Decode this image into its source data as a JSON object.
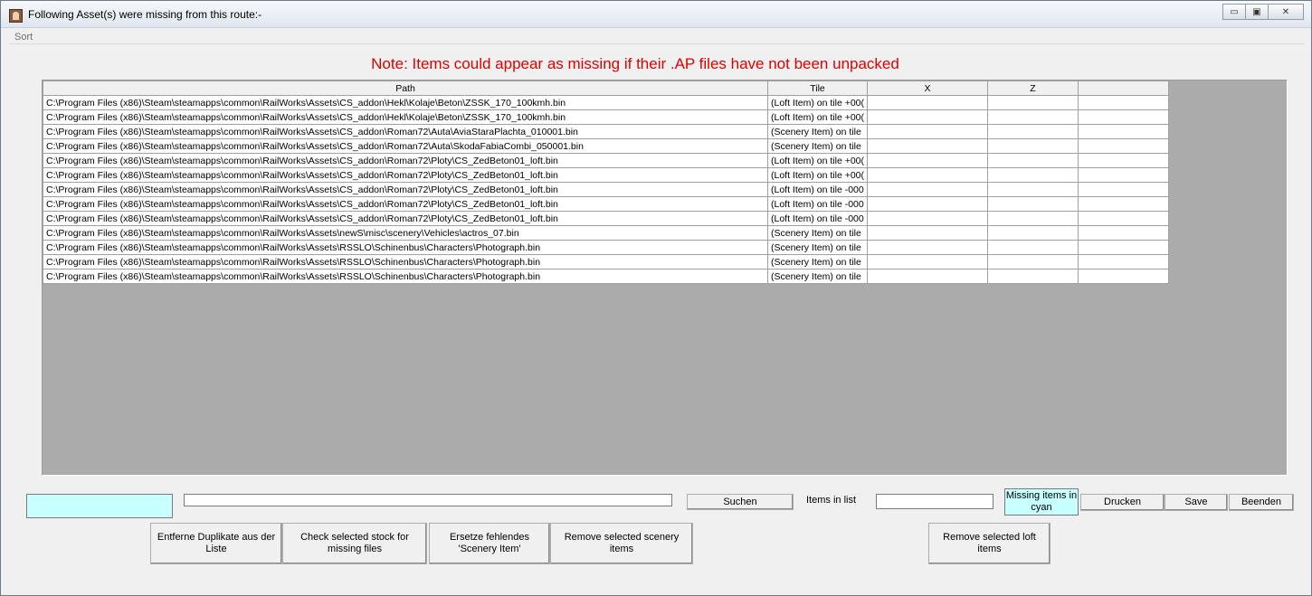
{
  "window": {
    "title": "Following Asset(s) were missing from this route:-",
    "minimize_glyph": "▭",
    "maximize_glyph": "▣",
    "close_glyph": "✕"
  },
  "menu": {
    "sort": "Sort"
  },
  "note": "Note: Items could appear as missing if their .AP files have not been unpacked",
  "table": {
    "headers": [
      "Path",
      "Tile",
      "X",
      "Z",
      ""
    ],
    "rows": [
      [
        "C:\\Program Files (x86)\\Steam\\steamapps\\common\\RailWorks\\Assets\\CS_addon\\Hekl\\Kolaje\\Beton\\ZSSK_170_100kmh.bin",
        "(Loft Item) on tile +00(",
        "",
        "",
        ""
      ],
      [
        "C:\\Program Files (x86)\\Steam\\steamapps\\common\\RailWorks\\Assets\\CS_addon\\Hekl\\Kolaje\\Beton\\ZSSK_170_100kmh.bin",
        "(Loft Item) on tile +00(",
        "",
        "",
        ""
      ],
      [
        "C:\\Program Files (x86)\\Steam\\steamapps\\common\\RailWorks\\Assets\\CS_addon\\Roman72\\Auta\\AviaStaraPlachta_010001.bin",
        "(Scenery Item) on tile",
        "",
        "",
        ""
      ],
      [
        "C:\\Program Files (x86)\\Steam\\steamapps\\common\\RailWorks\\Assets\\CS_addon\\Roman72\\Auta\\SkodaFabiaCombi_050001.bin",
        "(Scenery Item) on tile",
        "",
        "",
        ""
      ],
      [
        "C:\\Program Files (x86)\\Steam\\steamapps\\common\\RailWorks\\Assets\\CS_addon\\Roman72\\Ploty\\CS_ZedBeton01_loft.bin",
        "(Loft Item) on tile +00(",
        "",
        "",
        ""
      ],
      [
        "C:\\Program Files (x86)\\Steam\\steamapps\\common\\RailWorks\\Assets\\CS_addon\\Roman72\\Ploty\\CS_ZedBeton01_loft.bin",
        "(Loft Item) on tile +00(",
        "",
        "",
        ""
      ],
      [
        "C:\\Program Files (x86)\\Steam\\steamapps\\common\\RailWorks\\Assets\\CS_addon\\Roman72\\Ploty\\CS_ZedBeton01_loft.bin",
        "(Loft Item) on tile -000",
        "",
        "",
        ""
      ],
      [
        "C:\\Program Files (x86)\\Steam\\steamapps\\common\\RailWorks\\Assets\\CS_addon\\Roman72\\Ploty\\CS_ZedBeton01_loft.bin",
        "(Loft Item) on tile -000",
        "",
        "",
        ""
      ],
      [
        "C:\\Program Files (x86)\\Steam\\steamapps\\common\\RailWorks\\Assets\\CS_addon\\Roman72\\Ploty\\CS_ZedBeton01_loft.bin",
        "(Loft Item) on tile -000",
        "",
        "",
        ""
      ],
      [
        "C:\\Program Files (x86)\\Steam\\steamapps\\common\\RailWorks\\Assets\\newS\\misc\\scenery\\Vehicles\\actros_07.bin",
        "(Scenery Item) on tile",
        "",
        "",
        ""
      ],
      [
        "C:\\Program Files (x86)\\Steam\\steamapps\\common\\RailWorks\\Assets\\RSSLO\\Schinenbus\\Characters\\Photograph.bin",
        "(Scenery Item) on tile",
        "",
        "",
        ""
      ],
      [
        "C:\\Program Files (x86)\\Steam\\steamapps\\common\\RailWorks\\Assets\\RSSLO\\Schinenbus\\Characters\\Photograph.bin",
        "(Scenery Item) on tile",
        "",
        "",
        ""
      ],
      [
        "C:\\Program Files (x86)\\Steam\\steamapps\\common\\RailWorks\\Assets\\RSSLO\\Schinenbus\\Characters\\Photograph.bin",
        "(Scenery Item) on tile",
        "",
        "",
        ""
      ]
    ]
  },
  "controls": {
    "search_button": "Suchen",
    "items_in_list_label": "Items in list",
    "missing_cyan": "Missing items in cyan",
    "print_button": "Drucken",
    "save_button": "Save",
    "exit_button": "Beenden",
    "remove_duplicates_button": "Entferne Duplikate aus der Liste",
    "check_stock_button": "Check selected stock for missing files",
    "replace_scenery_button": "Ersetze fehlendes 'Scenery Item'",
    "remove_scenery_button": "Remove selected scenery items",
    "remove_loft_button": "Remove selected loft items"
  },
  "colors": {
    "note": "#e00000",
    "cyan": "#c8ffff",
    "grid_background": "#ababab"
  }
}
